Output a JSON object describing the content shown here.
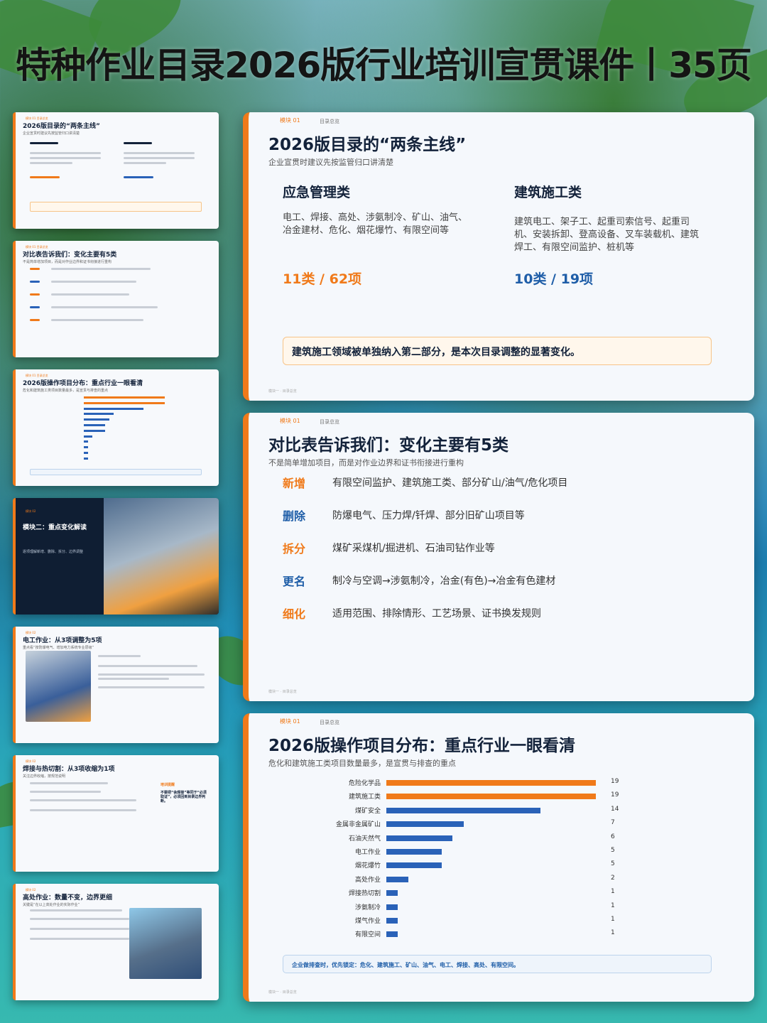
{
  "header": {
    "title": "特种作业目录2026版行业培训宣贯课件丨35页"
  },
  "thumbnails": [
    {
      "tag": "模块 01  目录总览",
      "title": "2026版目录的“两条主线”",
      "subtitle": "企业宣贯时建议先按监管归口讲清楚"
    },
    {
      "tag": "模块 01  目录总览",
      "title": "对比表告诉我们：变化主要有5类",
      "subtitle": "不是简单增加项目，而是对作业边界和证书衔接进行重构"
    },
    {
      "tag": "模块 01  目录总览",
      "title": "2026版操作项目分布：重点行业一眼看清",
      "subtitle": "危化和建筑施工类项目数量最多，是宣贯与排查的重点"
    },
    {
      "tag": "模块 02",
      "title": "模块二：重点变化解读",
      "subtitle": "逐项理解新增、删除、拆分、边界调整"
    },
    {
      "tag": "模块 02",
      "title": "电工作业：从3项调整为5项",
      "subtitle": "重点看“按防爆电气、增加电力系统专业层级”"
    },
    {
      "tag": "模块 02",
      "title": "焊接与热切割：从3项收缩为1项",
      "subtitle": "关注边界收缩，按规范说明",
      "side_title": "培训提醒",
      "side_text": "不要把“会焊接”等同于“必须取证”，必须回到目录边界判断。"
    },
    {
      "tag": "模块 02",
      "title": "高处作业：数量不变，边界更细",
      "subtitle": "关键是“在以上高处作业的实际作业”"
    }
  ],
  "slide1": {
    "module_tag": "模块 01",
    "module_name": "目录总览",
    "title": "2026版目录的“两条主线”",
    "subtitle": "企业宣贯时建议先按监管归口讲清楚",
    "left": {
      "heading": "应急管理类",
      "text": "电工、焊接、高处、涉氨制冷、矿山、油气、冶金建材、危化、烟花爆竹、有限空间等",
      "count": "11类 / 62项"
    },
    "right": {
      "heading": "建筑施工类",
      "text": "建筑电工、架子工、起重司索信号、起重司机、安装拆卸、登高设备、叉车装载机、建筑焊工、有限空间监护、桩机等",
      "count": "10类 / 19项"
    },
    "note": "建筑施工领域被单独纳入第二部分，是本次目录调整的显著变化。",
    "footer_left": "模块一 · 目录总览"
  },
  "slide2": {
    "module_tag": "模块 01",
    "module_name": "目录总览",
    "title": "对比表告诉我们：变化主要有5类",
    "subtitle": "不是简单增加项目，而是对作业边界和证书衔接进行重构",
    "rows": [
      {
        "key": "新增",
        "value": "有限空间监护、建筑施工类、部分矿山/油气/危化项目",
        "color": "#f07a1a"
      },
      {
        "key": "删除",
        "value": "防爆电气、压力焊/钎焊、部分旧矿山项目等",
        "color": "#1f5ea8"
      },
      {
        "key": "拆分",
        "value": "煤矿采煤机/掘进机、石油司钻作业等",
        "color": "#f07a1a"
      },
      {
        "key": "更名",
        "value": "制冷与空调→涉氨制冷，冶金(有色)→冶金有色建材",
        "color": "#1f5ea8"
      },
      {
        "key": "细化",
        "value": "适用范围、排除情形、工艺场景、证书换发规则",
        "color": "#f07a1a"
      }
    ],
    "footer_left": "模块一 · 目录总览"
  },
  "slide3": {
    "module_tag": "模块 01",
    "module_name": "目录总览",
    "title": "2026版操作项目分布：重点行业一眼看清",
    "subtitle": "危化和建筑施工类项目数量最多，是宣贯与排查的重点",
    "note": "企业做排查时，优先锁定：危化、建筑施工、矿山、油气、电工、焊接、高处、有限空间。",
    "footer_left": "模块一 · 目录总览"
  },
  "chart_data": {
    "type": "bar",
    "orientation": "horizontal",
    "categories": [
      "危险化学品",
      "建筑施工类",
      "煤矿安全",
      "金属非金属矿山",
      "石油天然气",
      "电工作业",
      "烟花爆竹",
      "高处作业",
      "焊接热切割",
      "涉氨制冷",
      "煤气作业",
      "有限空间"
    ],
    "values": [
      19,
      19,
      14,
      7,
      6,
      5,
      5,
      2,
      1,
      1,
      1,
      1
    ],
    "colors": [
      "#f07a1a",
      "#f07a1a",
      "#2a62b8",
      "#2a62b8",
      "#2a62b8",
      "#2a62b8",
      "#2a62b8",
      "#2a62b8",
      "#2a62b8",
      "#2a62b8",
      "#2a62b8",
      "#2a62b8"
    ],
    "xlim": [
      0,
      20
    ],
    "grid": false,
    "title": "",
    "xlabel": "",
    "ylabel": ""
  }
}
